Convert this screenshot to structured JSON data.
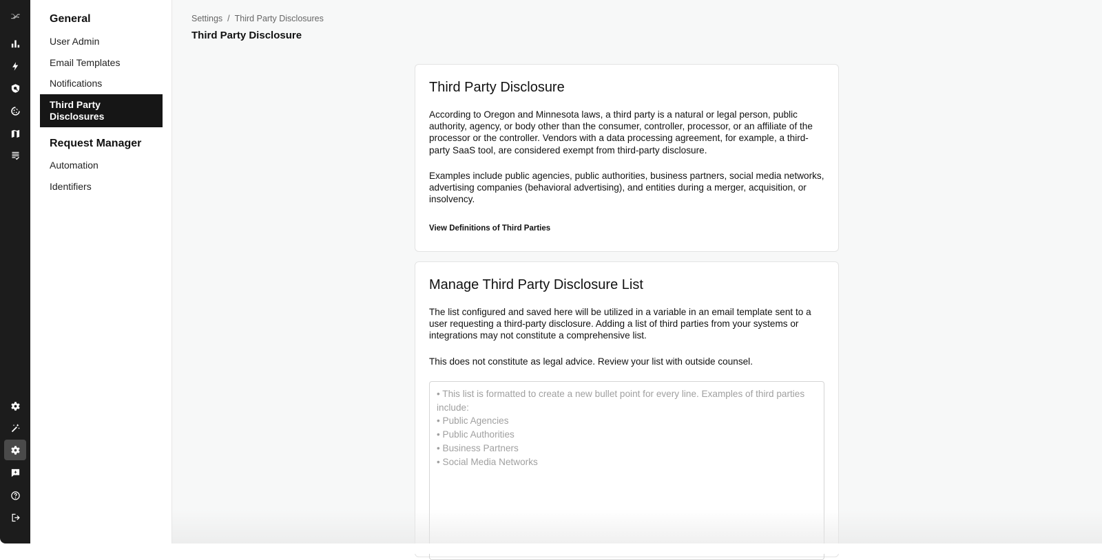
{
  "rail": {
    "top": [
      "logo-icon",
      "analytics-icon",
      "bolt-icon",
      "privacy-shield-icon",
      "cookie-icon",
      "map-icon",
      "checklist-icon"
    ],
    "bottom": [
      "gear-icon",
      "magic-wand-icon",
      "settings-icon",
      "feedback-icon",
      "help-icon",
      "logout-icon"
    ]
  },
  "sidebar": {
    "general": "General",
    "items": [
      "User Admin",
      "Email Templates",
      "Notifications",
      "Third Party Disclosures"
    ],
    "request_manager": "Request Manager",
    "rm_items": [
      "Automation",
      "Identifiers"
    ]
  },
  "breadcrumb": {
    "root": "Settings",
    "sep": "/",
    "current": "Third Party Disclosures"
  },
  "page_title": "Third Party Disclosure",
  "card1": {
    "title": "Third Party Disclosure",
    "p1": "According to Oregon and Minnesota laws, a third party is a natural or legal person, public authority, agency, or body other than the consumer, controller, processor, or an affiliate of the processor or the controller. Vendors with a data processing agreement, for example, a third-party SaaS tool, are considered exempt from third-party disclosure.",
    "p2": "Examples include public agencies, public authorities, business partners, social media networks, advertising companies (behavioral advertising), and entities during a merger, acquisition, or insolvency.",
    "link": "View Definitions of Third Parties"
  },
  "card2": {
    "title": "Manage Third Party Disclosure List",
    "p1": "The list configured and saved here will be utilized in a variable in an email template sent to a user requesting a third-party disclosure. Adding a list of third parties from your systems or integrations may not constitute a comprehensive list.",
    "p2": "This does not constitute as legal advice. Review your list with outside counsel.",
    "placeholder": "• This list is formatted to create a new bullet point for every line. Examples of third parties include:\n• Public Agencies\n• Public Authorities\n• Business Partners\n• Social Media Networks",
    "value": ""
  }
}
